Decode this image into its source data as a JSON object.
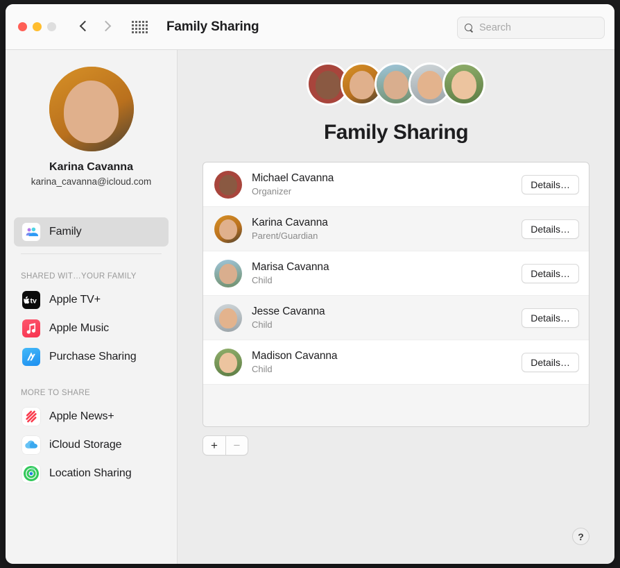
{
  "window": {
    "title": "Family Sharing",
    "traffic_lights": [
      "close-red",
      "minimize-yellow",
      "zoom-gray"
    ],
    "back_label": "Back",
    "forward_label": "Forward",
    "grid_label": "Show All"
  },
  "search": {
    "placeholder": "Search",
    "value": "",
    "icon": "search-icon"
  },
  "sidebar": {
    "profile": {
      "name": "Karina Cavanna",
      "email": "karina_cavanna@icloud.com",
      "avatar": "karina-avatar"
    },
    "primary": [
      {
        "label": "Family",
        "icon": "family-icon",
        "selected": true
      }
    ],
    "shared_header": "SHARED WIT…YOUR FAMILY",
    "shared_items": [
      {
        "label": "Apple TV+",
        "icon": "apple-tv-icon"
      },
      {
        "label": "Apple Music",
        "icon": "apple-music-icon"
      },
      {
        "label": "Purchase Sharing",
        "icon": "app-store-icon"
      }
    ],
    "more_header": "MORE TO SHARE",
    "more_items": [
      {
        "label": "Apple News+",
        "icon": "apple-news-icon"
      },
      {
        "label": "iCloud Storage",
        "icon": "icloud-icon"
      },
      {
        "label": "Location Sharing",
        "icon": "find-my-icon"
      }
    ]
  },
  "main": {
    "page_title": "Family Sharing",
    "cluster": [
      {
        "name": "Michael Cavanna",
        "photo": "michael"
      },
      {
        "name": "Karina Cavanna",
        "photo": "karina"
      },
      {
        "name": "Marisa Cavanna",
        "photo": "marisa"
      },
      {
        "name": "Jesse Cavanna",
        "photo": "jesse"
      },
      {
        "name": "Madison Cavanna",
        "photo": "madison"
      }
    ],
    "members": [
      {
        "name": "Michael Cavanna",
        "role": "Organizer",
        "button": "Details…",
        "photo": "michael"
      },
      {
        "name": "Karina Cavanna",
        "role": "Parent/Guardian",
        "button": "Details…",
        "photo": "karina"
      },
      {
        "name": "Marisa Cavanna",
        "role": "Child",
        "button": "Details…",
        "photo": "marisa"
      },
      {
        "name": "Jesse Cavanna",
        "role": "Child",
        "button": "Details…",
        "photo": "jesse"
      },
      {
        "name": "Madison Cavanna",
        "role": "Child",
        "button": "Details…",
        "photo": "madison"
      }
    ],
    "add_label": "+",
    "remove_label": "−",
    "help_label": "?"
  },
  "colors": {
    "window_bg": "#ececec",
    "sidebar_bg": "#f3f3f3",
    "titlebar_bg": "#fafafa",
    "selected_row": "#dcdcdc",
    "alt_row": "#f5f5f5",
    "close": "#ff5f56",
    "minimize": "#ffbd2e",
    "zoom": "#dedede",
    "music_red": "#f8334f",
    "appstore_blue": "#1c8ef0",
    "news_red": "#fa3b4d",
    "icloud_blue": "#3aa8ef",
    "findmy_green": "#32c85a"
  }
}
